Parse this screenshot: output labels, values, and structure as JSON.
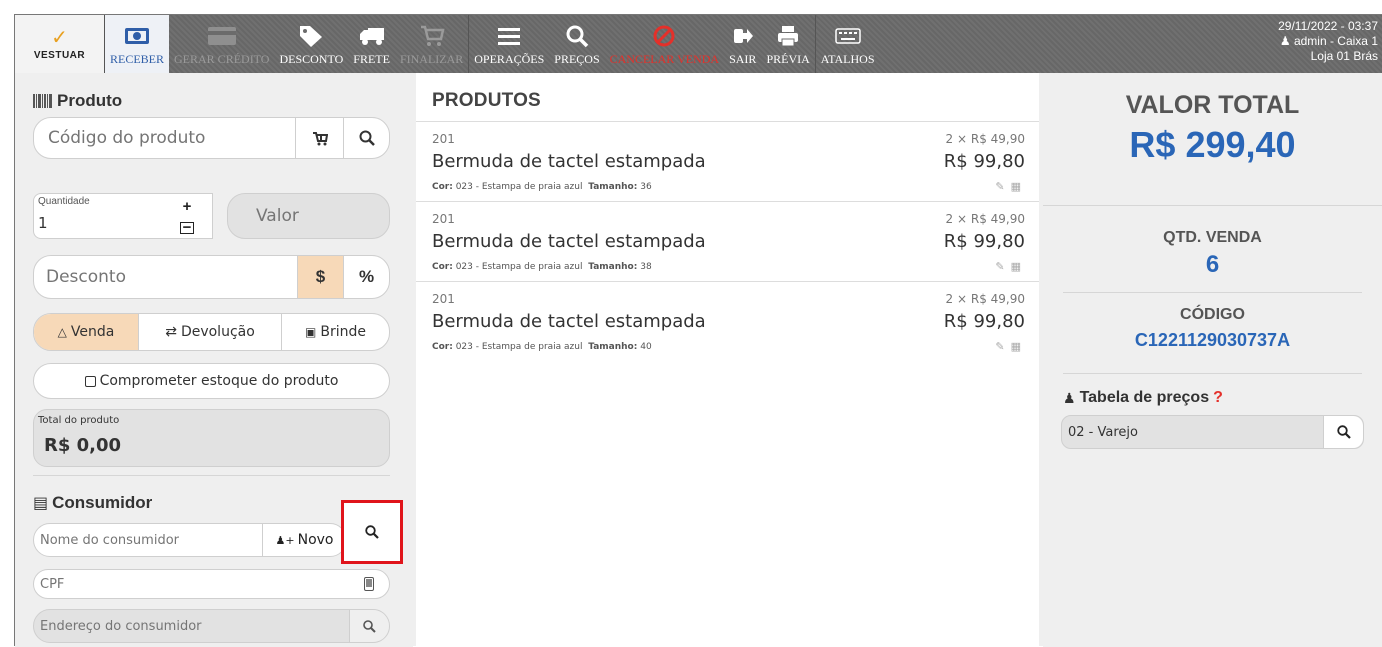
{
  "toolbar": {
    "logo": "VESTUAR",
    "items": [
      {
        "label": "RECEBER",
        "state": "active"
      },
      {
        "label": "GERAR CRÉDITO",
        "state": "disabled"
      },
      {
        "label": "DESCONTO",
        "state": "normal"
      },
      {
        "label": "FRETE",
        "state": "normal"
      },
      {
        "label": "FINALIZAR",
        "state": "disabled"
      },
      {
        "label": "OPERAÇÕES",
        "state": "normal"
      },
      {
        "label": "PREÇOS",
        "state": "normal"
      },
      {
        "label": "CANCELAR VENDA",
        "state": "danger"
      },
      {
        "label": "SAIR",
        "state": "normal"
      },
      {
        "label": "PRÉVIA",
        "state": "normal"
      },
      {
        "label": "ATALHOS",
        "state": "normal"
      }
    ],
    "datetime": "29/11/2022 - 03:37",
    "user": "admin - Caixa 1",
    "store": "Loja 01 Brás"
  },
  "produto": {
    "title": "Produto",
    "codigo_placeholder": "Código do produto",
    "quantidade_label": "Quantidade",
    "quantidade_value": "1",
    "valor_placeholder": "Valor",
    "desconto_placeholder": "Desconto",
    "desconto_money": "$",
    "desconto_percent": "%",
    "mode_venda": "Venda",
    "mode_devolucao": "Devolução",
    "mode_brinde": "Brinde",
    "comprometer": "Comprometer estoque do produto",
    "total_label": "Total do produto",
    "total_value": "R$ 0,00"
  },
  "consumidor": {
    "title": "Consumidor",
    "nome_placeholder": "Nome do consumidor",
    "novo_label": "Novo",
    "cpf_placeholder": "CPF",
    "endereco_placeholder": "Endereço do consumidor"
  },
  "produtos": {
    "title": "PRODUTOS",
    "items": [
      {
        "code": "201",
        "name": "Bermuda de tactel estampada",
        "cor_label": "Cor:",
        "cor": "023 - Estampa de praia azul",
        "tamanho_label": "Tamanho:",
        "tamanho": "36",
        "qty": "2 × R$ 49,90",
        "total": "R$ 99,80"
      },
      {
        "code": "201",
        "name": "Bermuda de tactel estampada",
        "cor_label": "Cor:",
        "cor": "023 - Estampa de praia azul",
        "tamanho_label": "Tamanho:",
        "tamanho": "38",
        "qty": "2 × R$ 49,90",
        "total": "R$ 99,80"
      },
      {
        "code": "201",
        "name": "Bermuda de tactel estampada",
        "cor_label": "Cor:",
        "cor": "023 - Estampa de praia azul",
        "tamanho_label": "Tamanho:",
        "tamanho": "40",
        "qty": "2 × R$ 49,90",
        "total": "R$ 99,80"
      }
    ]
  },
  "summary": {
    "valor_total_label": "VALOR TOTAL",
    "valor_total": "R$ 299,40",
    "qtd_label": "QTD. VENDA",
    "qtd": "6",
    "codigo_label": "CÓDIGO",
    "codigo": "C1221129030737A",
    "tabela_label": "Tabela de preços",
    "tabela_help": "?",
    "tabela_value": "02 - Varejo"
  },
  "colors": {
    "accent": "#2a66b7",
    "danger": "#e4302a",
    "selected": "#f7d9b8",
    "highlight_box": "#e0141b"
  }
}
